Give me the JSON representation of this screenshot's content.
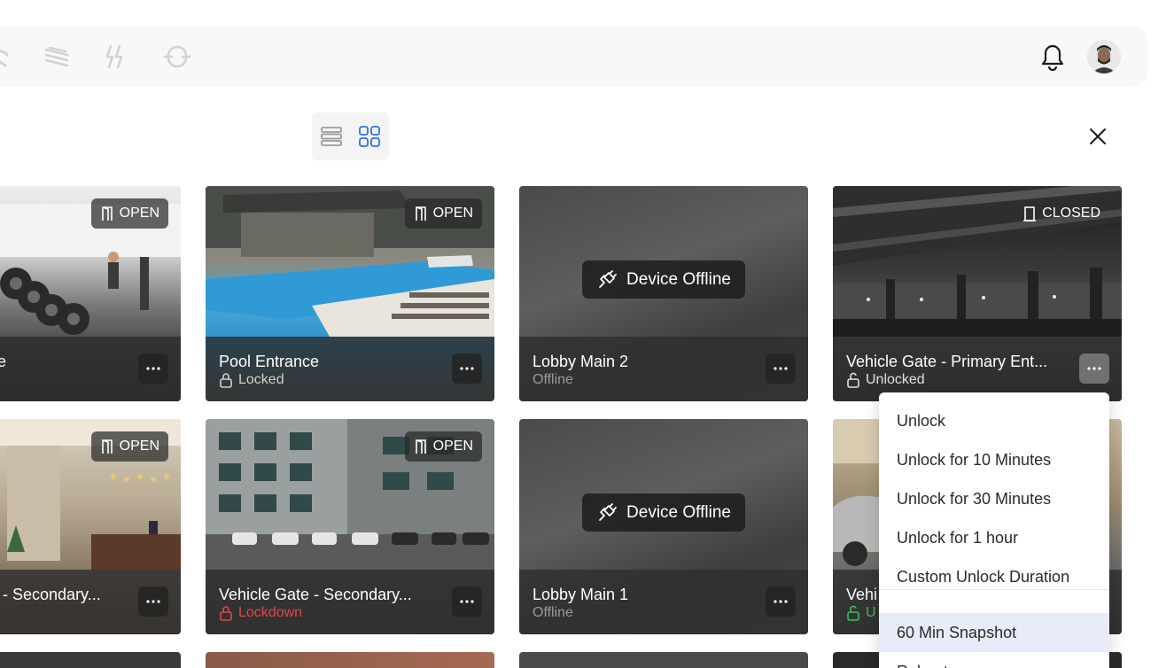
{
  "topbar": {
    "nav_icons": [
      "partial-icon",
      "layers-icon",
      "bolt-icon",
      "sync-icon"
    ],
    "bell_icon": "bell-icon",
    "avatar_icon": "avatar-icon"
  },
  "toolbar": {
    "list_view_icon": "list-view-icon",
    "grid_view_icon": "grid-view-icon",
    "close_icon": "close-icon"
  },
  "colors": {
    "accent": "#2f6fe0",
    "locked": "#d0d0d0",
    "lockdown": "#e04b42",
    "unlocked_green": "#3fbf5a",
    "offline": "#9a9a9a"
  },
  "cards": [
    {
      "name": "ce",
      "status": "",
      "badge": "OPEN"
    },
    {
      "name": "Pool Entrance",
      "status": "Locked",
      "badge": "OPEN"
    },
    {
      "name": "Lobby Main 2",
      "status": "Offline",
      "overlay": "Device Offline"
    },
    {
      "name": "Vehicle Gate - Primary Ent...",
      "status": "Unlocked",
      "badge": "CLOSED"
    },
    {
      "name": "e - Secondary...",
      "status": "",
      "badge": "OPEN"
    },
    {
      "name": "Vehicle Gate - Secondary...",
      "status": "Lockdown",
      "badge": "OPEN"
    },
    {
      "name": "Lobby Main 1",
      "status": "Offline",
      "overlay": "Device Offline"
    },
    {
      "name": "Vehi",
      "status": "U",
      "badge": ""
    }
  ],
  "menu": {
    "items": [
      "Unlock",
      "Unlock for 10 Minutes",
      "Unlock for 30 Minutes",
      "Unlock for 1 hour",
      "Custom Unlock Duration",
      "60 Min Snapshot",
      "Reboot"
    ]
  }
}
